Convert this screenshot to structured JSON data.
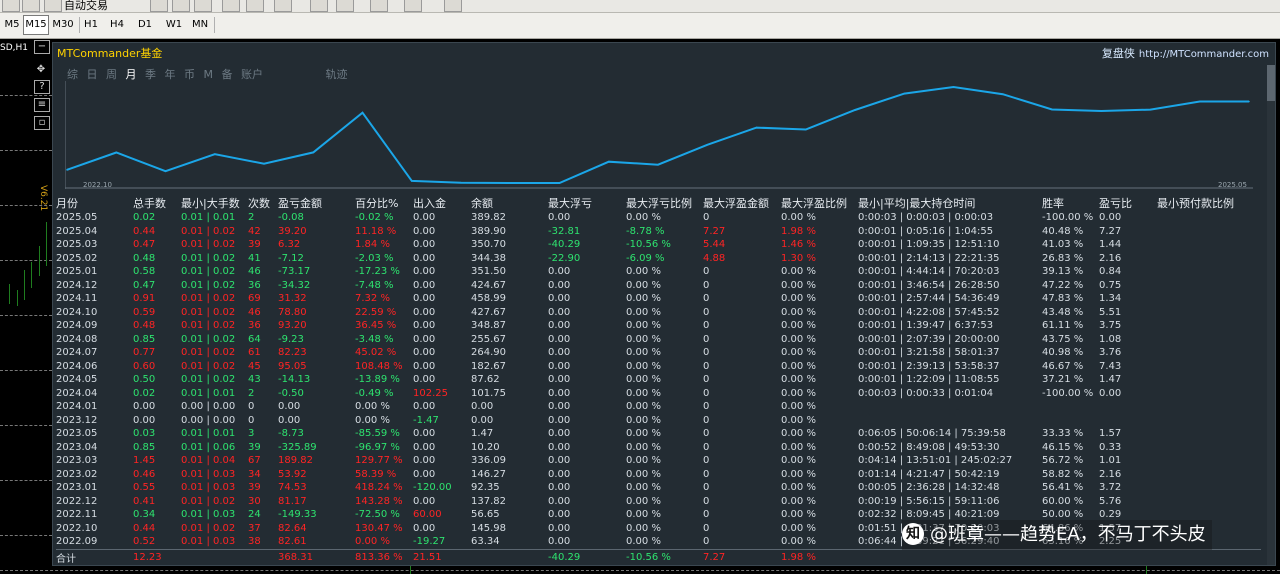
{
  "toolbar": {
    "top_label": "自动交易",
    "timeframes": [
      "M5",
      "M15",
      "M30",
      "H1",
      "H4",
      "D1",
      "W1",
      "MN"
    ],
    "active_timeframe": "M15"
  },
  "chart_bg": {
    "symbol": "SD,H1",
    "indicator_label": "V6.21"
  },
  "panel": {
    "title": "MTCommander基金",
    "right_title": "复盘侠",
    "right_url": "http://MTCommander.com",
    "tabs": [
      "综",
      "日",
      "周",
      "月",
      "季",
      "年",
      "币",
      "M",
      "备",
      "账户"
    ],
    "active_tab": "月",
    "tab_trail": "轨迹",
    "date_left": "2022.10",
    "date_right": "2025.05"
  },
  "chart_data": {
    "type": "line",
    "color": "#1ba6e8",
    "x": [
      "2022.09",
      "2022.10",
      "2022.11",
      "2022.12",
      "2023.01",
      "2023.02",
      "2023.03",
      "2023.04",
      "2023.05",
      "2023.12",
      "2024.01",
      "2024.04",
      "2024.05",
      "2024.06",
      "2024.07",
      "2024.08",
      "2024.09",
      "2024.10",
      "2024.11",
      "2024.12",
      "2025.01",
      "2025.02",
      "2025.03",
      "2025.04",
      "2025.05"
    ],
    "y": [
      63.34,
      145.98,
      56.65,
      137.82,
      92.35,
      146.27,
      336.09,
      10.2,
      1.47,
      0.0,
      0.0,
      101.75,
      87.62,
      182.67,
      264.9,
      255.67,
      348.87,
      427.67,
      458.99,
      424.67,
      351.5,
      344.38,
      350.7,
      389.9,
      389.82
    ]
  },
  "table": {
    "headers": [
      "月份",
      "总手数",
      "最小|大手数",
      "次数",
      "盈亏金额",
      "百分比%",
      "出入金",
      "余额",
      "最大浮亏",
      "最大浮亏比例",
      "最大浮盈金额",
      "最大浮盈比例",
      "最小|平均|最大持仓时间",
      "胜率",
      "盈亏比",
      "最小预付款比例"
    ],
    "rows": [
      {
        "c": [
          "2025.05",
          "0.02",
          "0.01 | 0.01",
          "2",
          "-0.08",
          "-0.02 %",
          "0.00",
          "389.82",
          "0.00",
          "0.00 %",
          "0",
          "0.00 %",
          "0:00:03 | 0:00:03 | 0:00:03",
          "-100.00 %",
          "0.00",
          ""
        ],
        "t": "g"
      },
      {
        "c": [
          "2025.04",
          "0.44",
          "0.01 | 0.02",
          "42",
          "39.20",
          "11.18 %",
          "0.00",
          "389.90",
          "-32.81",
          "-8.78 %",
          "7.27",
          "1.98 %",
          "0:00:01 | 0:05:16 | 1:04:55",
          "40.48 %",
          "7.27",
          ""
        ],
        "t": "r"
      },
      {
        "c": [
          "2025.03",
          "0.47",
          "0.01 | 0.02",
          "39",
          "6.32",
          "1.84 %",
          "0.00",
          "350.70",
          "-40.29",
          "-10.56 %",
          "5.44",
          "1.46 %",
          "0:00:01 | 1:09:35 | 12:51:10",
          "41.03 %",
          "1.44",
          ""
        ],
        "t": "r"
      },
      {
        "c": [
          "2025.02",
          "0.48",
          "0.01 | 0.02",
          "41",
          "-7.12",
          "-2.03 %",
          "0.00",
          "344.38",
          "-22.90",
          "-6.09 %",
          "4.88",
          "1.30 %",
          "0:00:01 | 2:14:13 | 22:21:35",
          "26.83 %",
          "2.16",
          ""
        ],
        "t": "g"
      },
      {
        "c": [
          "2025.01",
          "0.58",
          "0.01 | 0.02",
          "46",
          "-73.17",
          "-17.23 %",
          "0.00",
          "351.50",
          "0.00",
          "0.00 %",
          "0",
          "0.00 %",
          "0:00:01 | 4:44:14 | 70:20:03",
          "39.13 %",
          "0.84",
          ""
        ],
        "t": "g"
      },
      {
        "c": [
          "2024.12",
          "0.47",
          "0.01 | 0.02",
          "36",
          "-34.32",
          "-7.48 %",
          "0.00",
          "424.67",
          "0.00",
          "0.00 %",
          "0",
          "0.00 %",
          "0:00:01 | 3:46:54 | 26:28:50",
          "47.22 %",
          "0.75",
          ""
        ],
        "t": "g"
      },
      {
        "c": [
          "2024.11",
          "0.91",
          "0.01 | 0.02",
          "69",
          "31.32",
          "7.32 %",
          "0.00",
          "458.99",
          "0.00",
          "0.00 %",
          "0",
          "0.00 %",
          "0:00:01 | 2:57:44 | 54:36:49",
          "47.83 %",
          "1.34",
          ""
        ],
        "t": "r"
      },
      {
        "c": [
          "2024.10",
          "0.59",
          "0.01 | 0.02",
          "46",
          "78.80",
          "22.59 %",
          "0.00",
          "427.67",
          "0.00",
          "0.00 %",
          "0",
          "0.00 %",
          "0:00:01 | 4:22:08 | 57:45:52",
          "43.48 %",
          "5.51",
          ""
        ],
        "t": "r"
      },
      {
        "c": [
          "2024.09",
          "0.48",
          "0.01 | 0.02",
          "36",
          "93.20",
          "36.45 %",
          "0.00",
          "348.87",
          "0.00",
          "0.00 %",
          "0",
          "0.00 %",
          "0:00:01 | 1:39:47 | 6:37:53",
          "61.11 %",
          "3.75",
          ""
        ],
        "t": "r"
      },
      {
        "c": [
          "2024.08",
          "0.85",
          "0.01 | 0.02",
          "64",
          "-9.23",
          "-3.48 %",
          "0.00",
          "255.67",
          "0.00",
          "0.00 %",
          "0",
          "0.00 %",
          "0:00:01 | 2:07:39 | 20:00:00",
          "43.75 %",
          "1.08",
          ""
        ],
        "t": "g"
      },
      {
        "c": [
          "2024.07",
          "0.77",
          "0.01 | 0.02",
          "61",
          "82.23",
          "45.02 %",
          "0.00",
          "264.90",
          "0.00",
          "0.00 %",
          "0",
          "0.00 %",
          "0:00:01 | 3:21:58 | 58:01:37",
          "40.98 %",
          "3.76",
          ""
        ],
        "t": "r"
      },
      {
        "c": [
          "2024.06",
          "0.60",
          "0.01 | 0.02",
          "45",
          "95.05",
          "108.48 %",
          "0.00",
          "182.67",
          "0.00",
          "0.00 %",
          "0",
          "0.00 %",
          "0:00:01 | 2:39:13 | 53:58:37",
          "46.67 %",
          "7.43",
          ""
        ],
        "t": "r"
      },
      {
        "c": [
          "2024.05",
          "0.50",
          "0.01 | 0.02",
          "43",
          "-14.13",
          "-13.89 %",
          "0.00",
          "87.62",
          "0.00",
          "0.00 %",
          "0",
          "0.00 %",
          "0:00:01 | 1:22:09 | 11:08:55",
          "37.21 %",
          "1.47",
          ""
        ],
        "t": "g"
      },
      {
        "c": [
          "2024.04",
          "0.02",
          "0.01 | 0.01",
          "2",
          "-0.50",
          "-0.49 %",
          "102.25",
          "101.75",
          "0.00",
          "0.00 %",
          "0",
          "0.00 %",
          "0:00:03 | 0:00:33 | 0:01:04",
          "-100.00 %",
          "0.00",
          ""
        ],
        "t": "g"
      },
      {
        "c": [
          "2024.01",
          "0.00",
          "0.00 | 0.00",
          "0",
          "0.00",
          "0.00 %",
          "0.00",
          "0.00",
          "0.00",
          "0.00 %",
          "0",
          "0.00 %",
          "",
          "",
          "",
          ""
        ],
        "t": "w"
      },
      {
        "c": [
          "2023.12",
          "0.00",
          "0.00 | 0.00",
          "0",
          "0.00",
          "0.00 %",
          "-1.47",
          "0.00",
          "0.00",
          "0.00 %",
          "0",
          "0.00 %",
          "",
          "",
          "",
          ""
        ],
        "t": "w"
      },
      {
        "c": [
          "2023.05",
          "0.03",
          "0.01 | 0.01",
          "3",
          "-8.73",
          "-85.59 %",
          "0.00",
          "1.47",
          "0.00",
          "0.00 %",
          "0",
          "0.00 %",
          "0:06:05 | 50:06:14 | 75:39:58",
          "33.33 %",
          "1.57",
          ""
        ],
        "t": "g"
      },
      {
        "c": [
          "2023.04",
          "0.85",
          "0.01 | 0.06",
          "39",
          "-325.89",
          "-96.97 %",
          "0.00",
          "10.20",
          "0.00",
          "0.00 %",
          "0",
          "0.00 %",
          "0:00:52 | 8:49:08 | 49:53:30",
          "46.15 %",
          "0.33",
          ""
        ],
        "t": "g"
      },
      {
        "c": [
          "2023.03",
          "1.45",
          "0.01 | 0.04",
          "67",
          "189.82",
          "129.77 %",
          "0.00",
          "336.09",
          "0.00",
          "0.00 %",
          "0",
          "0.00 %",
          "0:04:14 | 13:51:01 | 245:02:27",
          "56.72 %",
          "1.01",
          ""
        ],
        "t": "r"
      },
      {
        "c": [
          "2023.02",
          "0.46",
          "0.01 | 0.03",
          "34",
          "53.92",
          "58.39 %",
          "0.00",
          "146.27",
          "0.00",
          "0.00 %",
          "0",
          "0.00 %",
          "0:01:14 | 4:21:47 | 50:42:19",
          "58.82 %",
          "2.16",
          ""
        ],
        "t": "r"
      },
      {
        "c": [
          "2023.01",
          "0.55",
          "0.01 | 0.03",
          "39",
          "74.53",
          "418.24 %",
          "-120.00",
          "92.35",
          "0.00",
          "0.00 %",
          "0",
          "0.00 %",
          "0:00:05 | 2:36:28 | 14:32:48",
          "56.41 %",
          "3.72",
          ""
        ],
        "t": "r"
      },
      {
        "c": [
          "2022.12",
          "0.41",
          "0.01 | 0.02",
          "30",
          "81.17",
          "143.28 %",
          "0.00",
          "137.82",
          "0.00",
          "0.00 %",
          "0",
          "0.00 %",
          "0:00:19 | 5:56:15 | 59:11:06",
          "60.00 %",
          "5.76",
          ""
        ],
        "t": "r"
      },
      {
        "c": [
          "2022.11",
          "0.34",
          "0.01 | 0.03",
          "24",
          "-149.33",
          "-72.50 %",
          "60.00",
          "56.65",
          "0.00",
          "0.00 %",
          "0",
          "0.00 %",
          "0:02:32 | 8:09:45 | 40:21:09",
          "50.00 %",
          "0.29",
          ""
        ],
        "t": "g"
      },
      {
        "c": [
          "2022.10",
          "0.44",
          "0.01 | 0.02",
          "37",
          "82.64",
          "130.47 %",
          "0.00",
          "145.98",
          "0.00",
          "0.00 %",
          "0",
          "0.00 %",
          "0:01:51 | 8:31:37 | 70:20:03",
          "64.86 %",
          "1.57",
          ""
        ],
        "t": "r"
      },
      {
        "c": [
          "2022.09",
          "0.52",
          "0.01 | 0.03",
          "38",
          "82.61",
          "0.00 %",
          "-19.27",
          "63.34",
          "0.00",
          "0.00 %",
          "0",
          "0.00 %",
          "0:06:44 | 7:39:21 | 56:29:40",
          "63.16 %",
          "2.25",
          ""
        ],
        "t": "r"
      }
    ],
    "total": [
      "合计",
      "12.23",
      "",
      "",
      "368.31",
      "813.36 %",
      "21.51",
      "",
      "-40.29",
      "-10.56 %",
      "7.27",
      "1.98 %",
      "",
      "",
      "",
      ""
    ]
  },
  "watermark": {
    "icon": "知",
    "text": "@班章——趋势EA，不马丁不头皮"
  }
}
